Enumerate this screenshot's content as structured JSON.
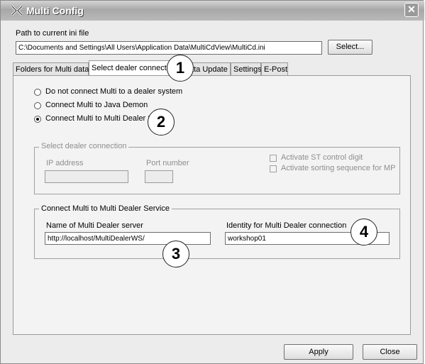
{
  "window": {
    "title": "Multi Config",
    "close_glyph": "✕",
    "app_icon": "multi-config-icon"
  },
  "path": {
    "label": "Path to current ini file",
    "value": "C:\\Documents and Settings\\All Users\\Application Data\\MultiCdView\\MultiCd.ini",
    "select_button": "Select..."
  },
  "tabs": [
    {
      "label": "Folders for Multi data",
      "active": false
    },
    {
      "label": "Select dealer connection",
      "active": true
    },
    {
      "label": "ata Update",
      "active": false
    },
    {
      "label": "Settings",
      "active": false
    },
    {
      "label": "E-Post",
      "active": false
    }
  ],
  "radios": [
    {
      "label": "Do not connect Multi to a dealer system",
      "checked": false
    },
    {
      "label": "Connect Multi to Java Demon",
      "checked": false
    },
    {
      "label": "Connect Multi to Multi Dealer Servi",
      "checked": true
    }
  ],
  "dealer_group": {
    "title": "Select dealer connection",
    "ip_label": "IP address",
    "ip_value": "",
    "port_label": "Port number",
    "port_value": "",
    "checkboxes": [
      {
        "label": "Activate ST control digit",
        "checked": false
      },
      {
        "label": "Activate sorting sequence for MP",
        "checked": false
      }
    ]
  },
  "mds_group": {
    "title": "Connect Multi to Multi Dealer Service",
    "server_label": "Name of Multi Dealer server",
    "server_value": "http://localhost/MultiDealerWS/",
    "identity_label": "Identity for Multi Dealer connection",
    "identity_value": "workshop01"
  },
  "callouts": [
    "1",
    "2",
    "3",
    "4"
  ],
  "footer": {
    "apply_button": "Apply",
    "close_button": "Close"
  },
  "colors": {
    "titlebar": "#b9b9b9",
    "window_bg": "#ececec",
    "panel_bg": "#f3f3f3"
  }
}
